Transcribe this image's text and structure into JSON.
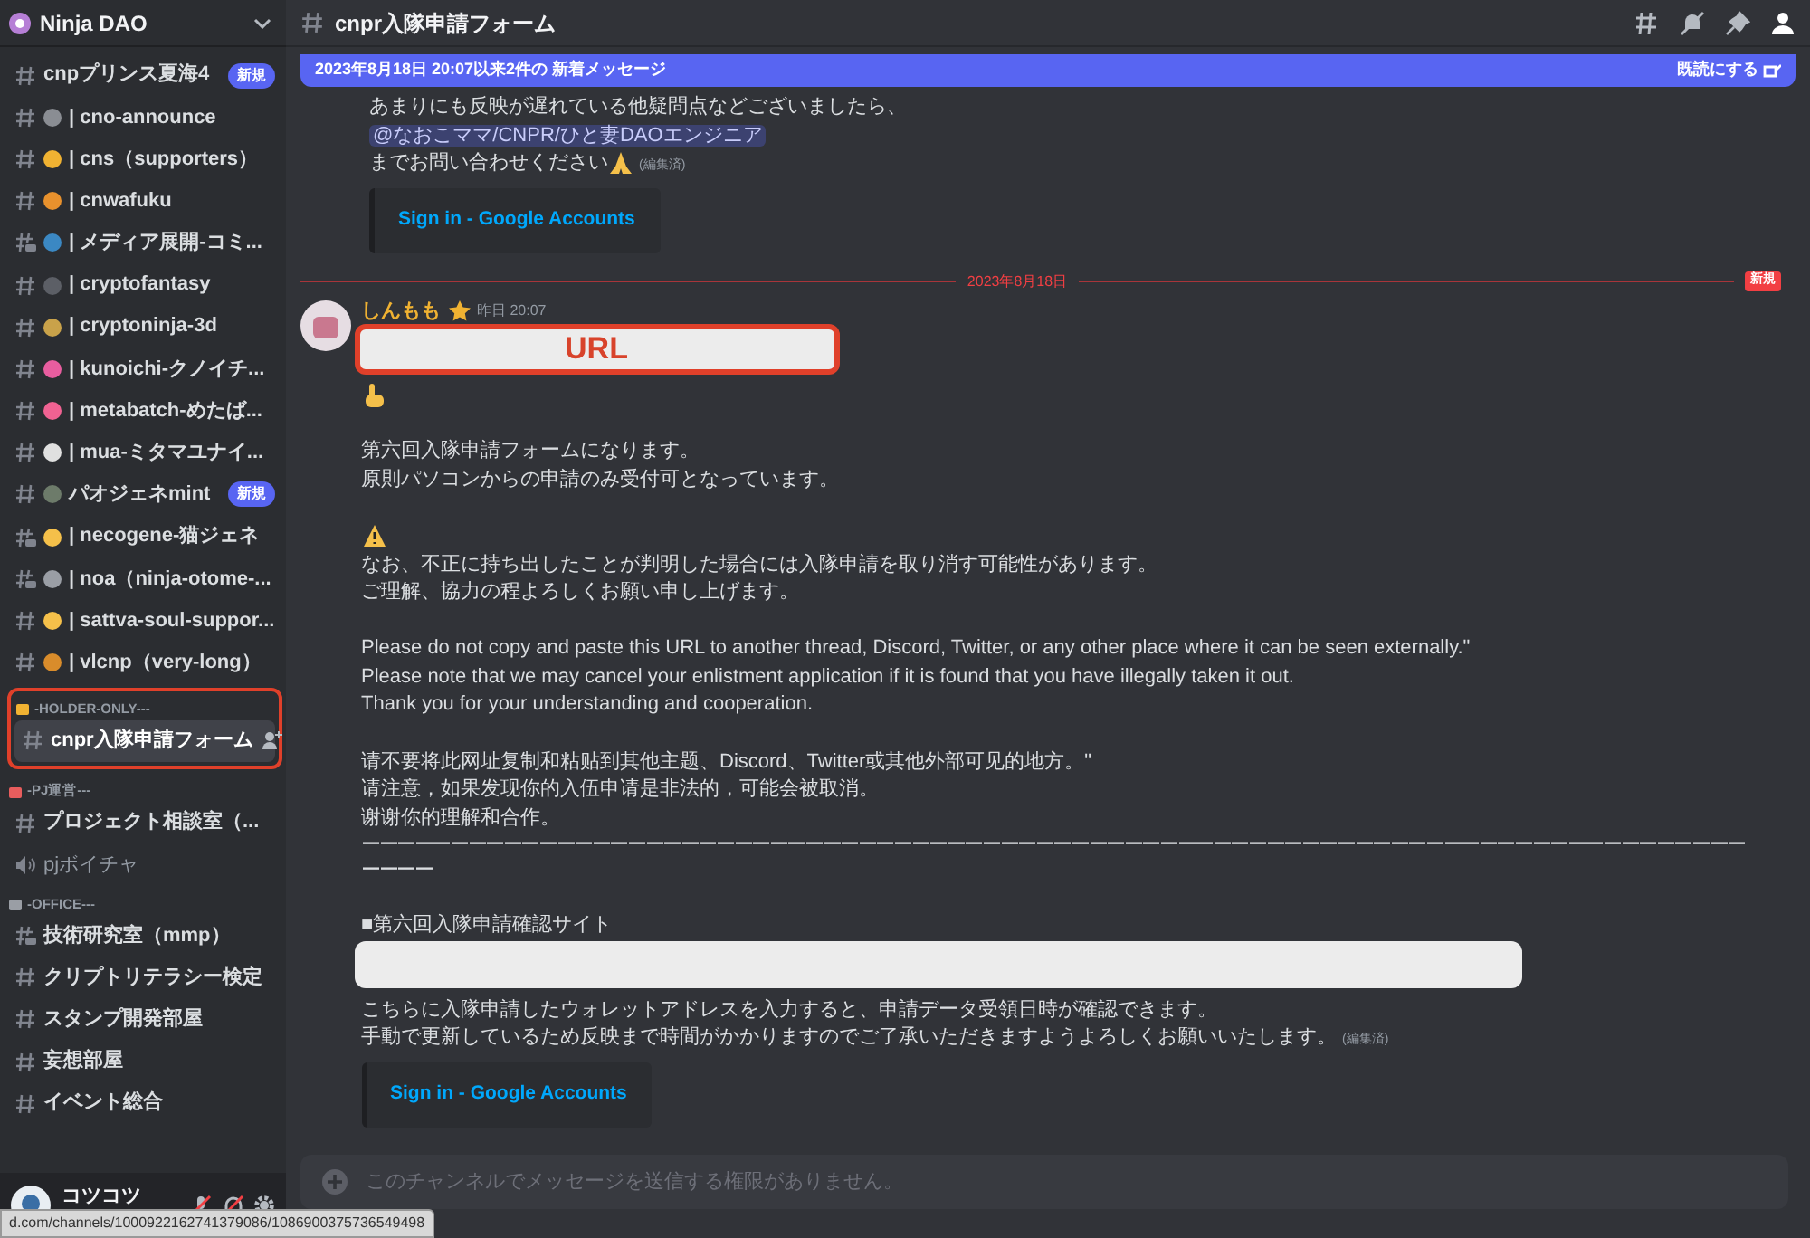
{
  "server": {
    "name": "Ninja DAO"
  },
  "sidebar": {
    "entries": [
      {
        "kind": "text_channel",
        "name": "cnpプリンス夏海4",
        "badge": "新規",
        "selected": false
      },
      {
        "kind": "text_channel",
        "color": "#8a8d93",
        "name": "| cno-announce",
        "selected": false
      },
      {
        "kind": "text_channel",
        "color": "#f0b232",
        "name": "| cns（supporters）",
        "selected": false
      },
      {
        "kind": "text_channel",
        "color": "#e8912d",
        "name": "| cnwafuku",
        "selected": false
      },
      {
        "kind": "forum_channel",
        "color": "#3b88c3",
        "name": "| メディア展開-コミ...",
        "selected": false
      },
      {
        "kind": "text_channel",
        "color": "#5c5f66",
        "name": "| cryptofantasy",
        "selected": false
      },
      {
        "kind": "text_channel",
        "color": "#c9a24a",
        "name": "| cryptoninja-3d",
        "selected": false
      },
      {
        "kind": "text_channel",
        "color": "#e85d9f",
        "name": "| kunoichi-クノイチ...",
        "selected": false
      },
      {
        "kind": "text_channel",
        "color": "#f06292",
        "name": "| metabatch-めたば...",
        "selected": false
      },
      {
        "kind": "text_channel",
        "color": "#e0e0e0",
        "name": "| mua-ミタマユナイ...",
        "selected": false
      },
      {
        "kind": "text_channel",
        "color": "#6d7b6a",
        "name": "パオジェネmint",
        "badge": "新規",
        "selected": false
      },
      {
        "kind": "forum_channel",
        "color": "#f5c04a",
        "name": "| necogene-猫ジェネ",
        "selected": false
      },
      {
        "kind": "forum_channel",
        "color": "#9a9ea5",
        "name": "| noa（ninja-otome-...",
        "selected": false
      },
      {
        "kind": "text_channel",
        "color": "#f5c04a",
        "name": "| sattva-soul-suppor...",
        "selected": false
      },
      {
        "kind": "text_channel",
        "color": "#d98c2b",
        "name": "| vlcnp（very-long）",
        "selected": false
      },
      {
        "kind": "category",
        "color": "#f0b232",
        "name": "-HOLDER-ONLY---",
        "annotated": true
      },
      {
        "kind": "text_channel",
        "name": "cnpr入隊申請フォーム",
        "selected": true,
        "annotated": true
      },
      {
        "kind": "category",
        "color": "#e85d5d",
        "name": "-PJ運営---"
      },
      {
        "kind": "text_channel",
        "name": "プロジェクト相談室（...",
        "selected": false
      },
      {
        "kind": "voice_channel",
        "name": "pjボイチャ",
        "selected": false
      },
      {
        "kind": "category",
        "color": "#9a9ea5",
        "name": "-OFFICE---"
      },
      {
        "kind": "forum_channel",
        "name": "技術研究室（mmp）",
        "selected": false
      },
      {
        "kind": "text_channel",
        "name": "クリプトリテラシー検定",
        "selected": false
      },
      {
        "kind": "text_channel",
        "name": "スタンプ開発部屋",
        "selected": false
      },
      {
        "kind": "text_channel",
        "name": "妄想部屋",
        "selected": false
      },
      {
        "kind": "text_channel",
        "name": "イベント総合",
        "selected": false
      }
    ]
  },
  "user": {
    "name": "コツコツ"
  },
  "status_url": "d.com/channels/1000922162741379086/1086900375736549498",
  "header": {
    "channel": "cnpr入隊申請フォーム"
  },
  "new_bar": {
    "text": "2023年8月18日 20:07以来2件の 新着メッセージ",
    "action": "既読にする"
  },
  "messages": [
    {
      "lines": [
        {
          "kind": "text",
          "text": "あまりにも反映が遅れている他疑問点などございましたら、"
        },
        {
          "kind": "mention",
          "text": "@なおこママ/CNPR/ひと妻DAOエンジニア"
        },
        {
          "kind": "text_pray",
          "text": "までお問い合わせください",
          "edited": "(編集済)"
        },
        {
          "kind": "embed",
          "text": "Sign in - Google Accounts"
        }
      ]
    },
    {
      "divider": {
        "date": "2023年8月18日",
        "tag": "新規"
      },
      "author": "しんもも",
      "time": "昨日 20:07",
      "lines": [
        {
          "kind": "urlbox",
          "text": "URL"
        },
        {
          "kind": "hand"
        },
        {
          "kind": "gap"
        },
        {
          "kind": "text",
          "text": "第六回入隊申請フォームになります。"
        },
        {
          "kind": "text",
          "text": "原則パソコンからの申請のみ受付可となっています。"
        },
        {
          "kind": "gap"
        },
        {
          "kind": "warning"
        },
        {
          "kind": "text",
          "text": "なお、不正に持ち出したことが判明した場合には入隊申請を取り消す可能性があります。"
        },
        {
          "kind": "text",
          "text": "ご理解、協力の程よろしくお願い申し上げます。"
        },
        {
          "kind": "gap"
        },
        {
          "kind": "text",
          "text": "Please do not copy and paste this URL to another thread, Discord, Twitter, or any other place where it can be seen externally.\""
        },
        {
          "kind": "text",
          "text": "Please note that we may cancel your enlistment application if it is found that you have illegally taken it out."
        },
        {
          "kind": "text",
          "text": "Thank you for your understanding and cooperation."
        },
        {
          "kind": "gap"
        },
        {
          "kind": "text",
          "text": "请不要将此网址复制和粘贴到其他主题、Discord、Twitter或其他外部可见的地方。\""
        },
        {
          "kind": "text",
          "text": "请注意，如果发现你的入伍申请是非法的，可能会被取消。"
        },
        {
          "kind": "text",
          "text": "谢谢你的理解和合作。"
        },
        {
          "kind": "rule",
          "text": "ーーーーーーーーーーーーーーーーーーーーーーーーーーーーーーーーーーーーーーーーーーーーーーーーーーーーーーーーーーーーーーーーーーーーーーーーーーーーーーーーーー"
        },
        {
          "kind": "gap"
        },
        {
          "kind": "text",
          "text": "■第六回入隊申請確認サイト"
        },
        {
          "kind": "redacted"
        },
        {
          "kind": "text",
          "text": "こちらに入隊申請したウォレットアドレスを入力すると、申請データ受領日時が確認できます。"
        },
        {
          "kind": "text",
          "text": "手動で更新しているため反映まで時間がかかりますのでご了承いただきますようよろしくお願いいたします。",
          "edited": "(編集済)"
        },
        {
          "kind": "embed",
          "text": "Sign in - Google Accounts"
        }
      ]
    }
  ],
  "composer": {
    "placeholder": "このチャンネルでメッセージを送信する権限がありません。"
  }
}
